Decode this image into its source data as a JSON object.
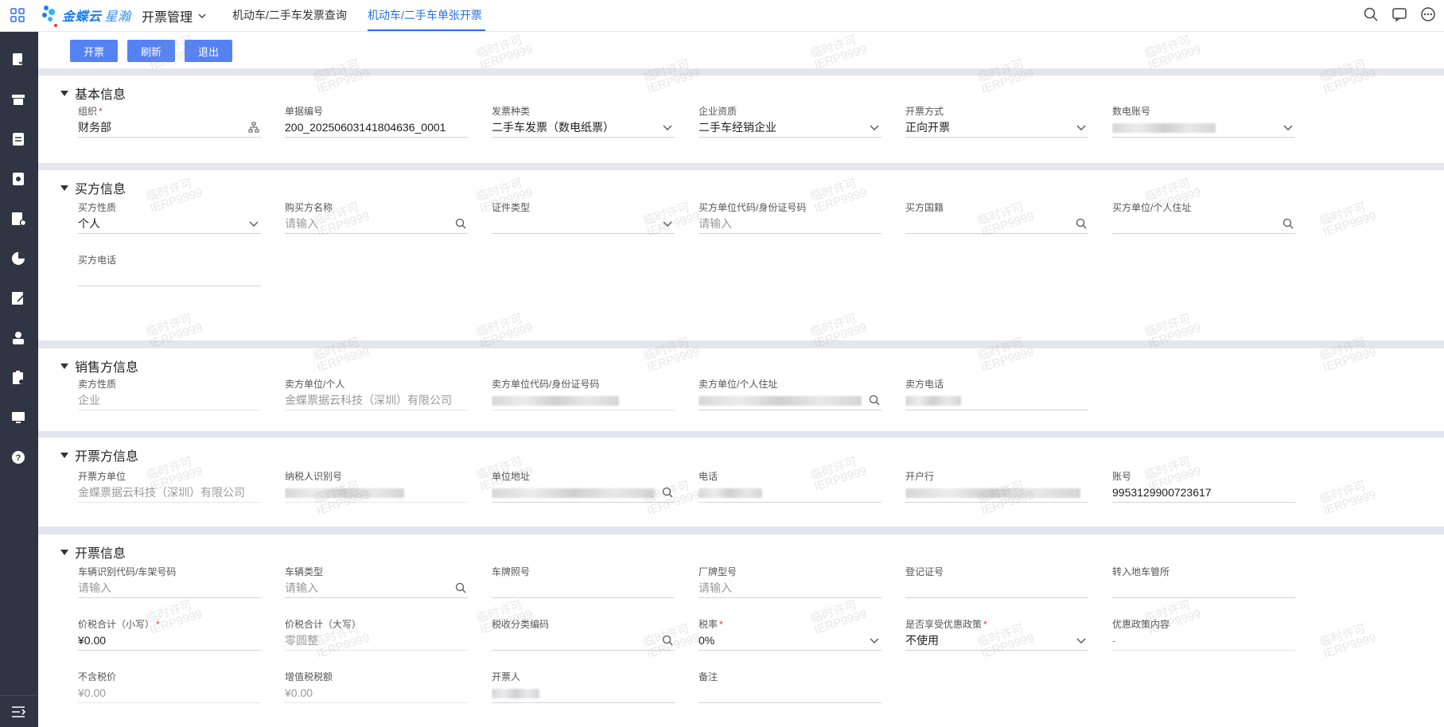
{
  "header": {
    "logo_text": "金蝶云",
    "logo_sub": "星瀚",
    "app_menu": "开票管理",
    "tabs": [
      {
        "label": "机动车/二手车发票查询",
        "active": false
      },
      {
        "label": "机动车/二手车单张开票",
        "active": true
      }
    ],
    "icons": [
      "search-icon",
      "message-icon",
      "more-icon"
    ]
  },
  "sidebar": {
    "icons": [
      "document-check-icon",
      "store-icon",
      "transfer-icon",
      "invoice-icon",
      "report-settings-icon",
      "pie-chart-icon",
      "edit-document-icon",
      "user-upload-icon",
      "clipboard-settings-icon",
      "monitor-icon",
      "help-icon"
    ],
    "bottom_icon": "menu-collapse-icon"
  },
  "toolbar": {
    "issue_label": "开票",
    "refresh_label": "刷新",
    "exit_label": "退出"
  },
  "sections": {
    "basic": {
      "title": "基本信息",
      "org_label": "组织",
      "org_value": "财务部",
      "billno_label": "单据编号",
      "billno_value": "200_20250603141804636_0001",
      "invtype_label": "发票种类",
      "invtype_value": "二手车发票（数电纸票）",
      "qual_label": "企业资质",
      "qual_value": "二手车经销企业",
      "method_label": "开票方式",
      "method_value": "正向开票",
      "account_label": "数电账号"
    },
    "buyer": {
      "title": "买方信息",
      "nature_label": "买方性质",
      "nature_value": "个人",
      "name_label": "购买方名称",
      "name_placeholder": "请输入",
      "idtype_label": "证件类型",
      "code_label": "买方单位代码/身份证号码",
      "code_placeholder": "请输入",
      "nation_label": "买方国籍",
      "addr_label": "买方单位/个人住址",
      "phone_label": "买方电话"
    },
    "seller": {
      "title": "销售方信息",
      "nature_label": "卖方性质",
      "nature_value": "企业",
      "name_label": "卖方单位/个人",
      "name_value": "金蝶票据云科技（深圳）有限公司",
      "code_label": "卖方单位代码/身份证号码",
      "addr_label": "卖方单位/个人住址",
      "phone_label": "卖方电话"
    },
    "issuer": {
      "title": "开票方信息",
      "unit_label": "开票方单位",
      "unit_value": "金蝶票据云科技（深圳）有限公司",
      "taxno_label": "纳税人识别号",
      "addr_label": "单位地址",
      "phone_label": "电话",
      "bank_label": "开户行",
      "acct_label": "账号",
      "acct_value": "9953129900723617"
    },
    "invoice": {
      "title": "开票信息",
      "vin_label": "车辆识别代码/车架号码",
      "vin_placeholder": "请输入",
      "vtype_label": "车辆类型",
      "vtype_placeholder": "请输入",
      "plate_label": "车牌照号",
      "model_label": "厂牌型号",
      "model_placeholder": "请输入",
      "reg_label": "登记证号",
      "dmv_label": "转入地车管所",
      "total_label": "价税合计（小写）",
      "total_value": "¥0.00",
      "total_cap_label": "价税合计（大写）",
      "total_cap_value": "零圆整",
      "taxcode_label": "税收分类编码",
      "rate_label": "税率",
      "rate_value": "0%",
      "pref_label": "是否享受优惠政策",
      "pref_value": "不使用",
      "pref_content_label": "优惠政策内容",
      "pref_content_value": "-",
      "notax_label": "不含税价",
      "notax_value": "¥0.00",
      "vat_label": "增值税税额",
      "vat_value": "¥0.00",
      "drawer_label": "开票人",
      "remark_label": "备注"
    }
  },
  "watermark": {
    "line1": "临时许可",
    "line2": "IERP9999"
  },
  "colors": {
    "primary": "#5582f3",
    "active_tab": "#276ff5",
    "sidebar": "#2f3542",
    "required": "#e53935"
  }
}
